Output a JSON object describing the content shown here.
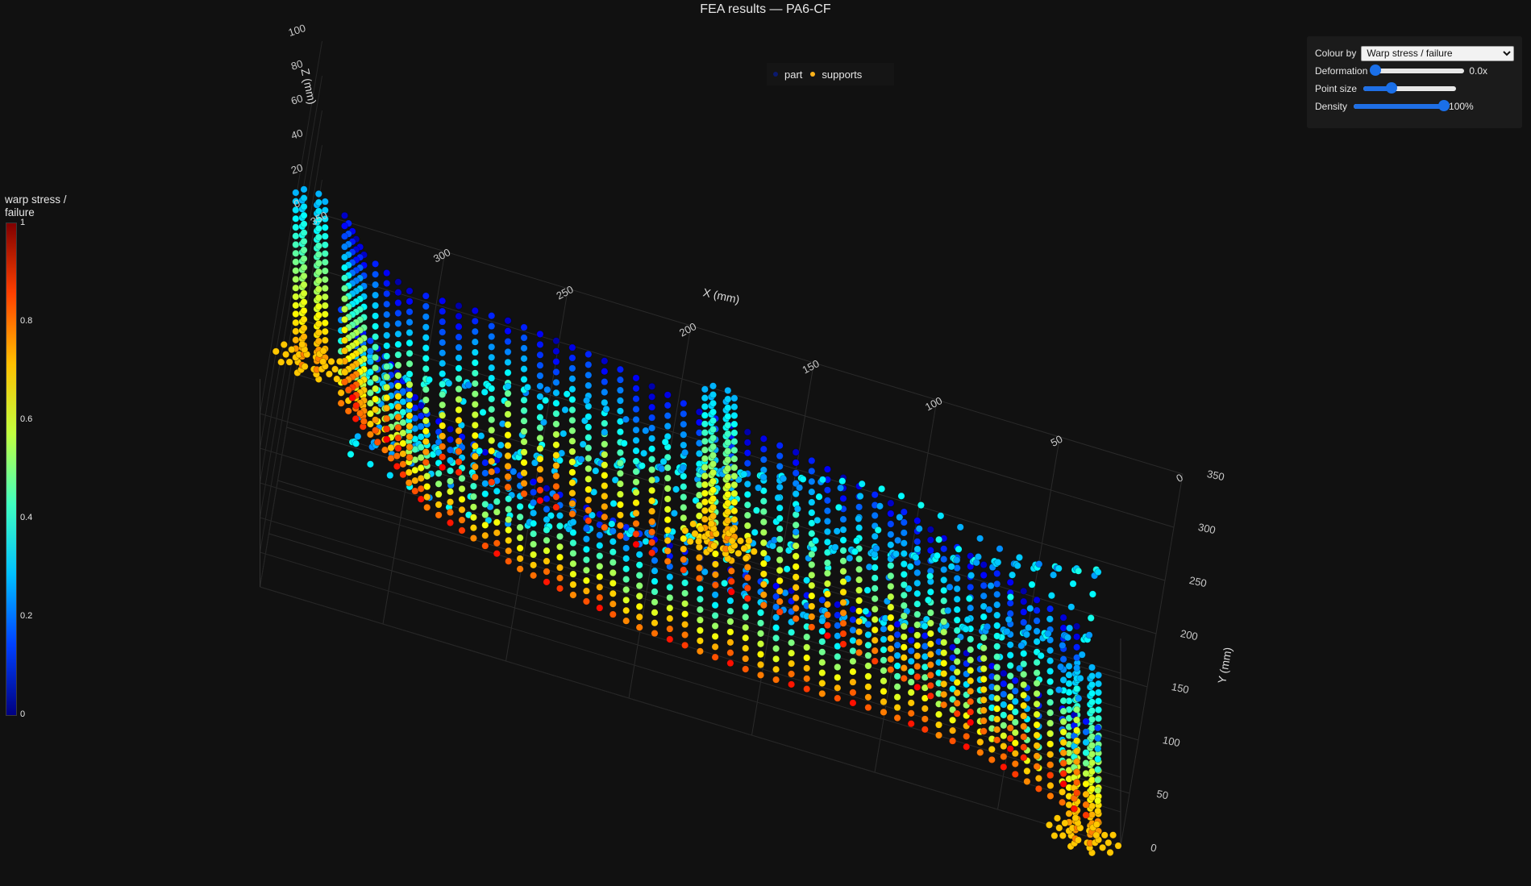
{
  "title": "FEA results — PA6-CF",
  "legend": [
    {
      "label": "part",
      "color": "#0b1a6e"
    },
    {
      "label": "supports",
      "color": "#ffb31a"
    }
  ],
  "colorbar": {
    "title_line1": "warp stress /",
    "title_line2": "failure",
    "ticks": [
      "1",
      "0.8",
      "0.6",
      "0.4",
      "0.2",
      "0"
    ],
    "colorscale": [
      "#000080",
      "#0040ff",
      "#00c0ff",
      "#40ffc0",
      "#c0ff40",
      "#ffc000",
      "#ff4000",
      "#800000"
    ]
  },
  "controls": {
    "colour_by_label": "Colour by",
    "colour_by_value": "Warp stress / failure",
    "deformation_label": "Deformation",
    "deformation_value": "0.0x",
    "deformation_level": 0.0,
    "point_size_label": "Point size",
    "point_size_level": 0.3,
    "density_label": "Density",
    "density_value": "100%",
    "density_level": 1.0
  },
  "axes": {
    "x_title": "X (mm)",
    "y_title": "Y (mm)",
    "z_title": "Z (mm)",
    "x_ticks": [
      "350",
      "300",
      "250",
      "200",
      "150",
      "100",
      "50",
      "0"
    ],
    "y_ticks": [
      "0",
      "50",
      "100",
      "150",
      "200",
      "250",
      "300",
      "350"
    ],
    "z_ticks": [
      "0",
      "20",
      "40",
      "60",
      "80",
      "100"
    ]
  }
}
